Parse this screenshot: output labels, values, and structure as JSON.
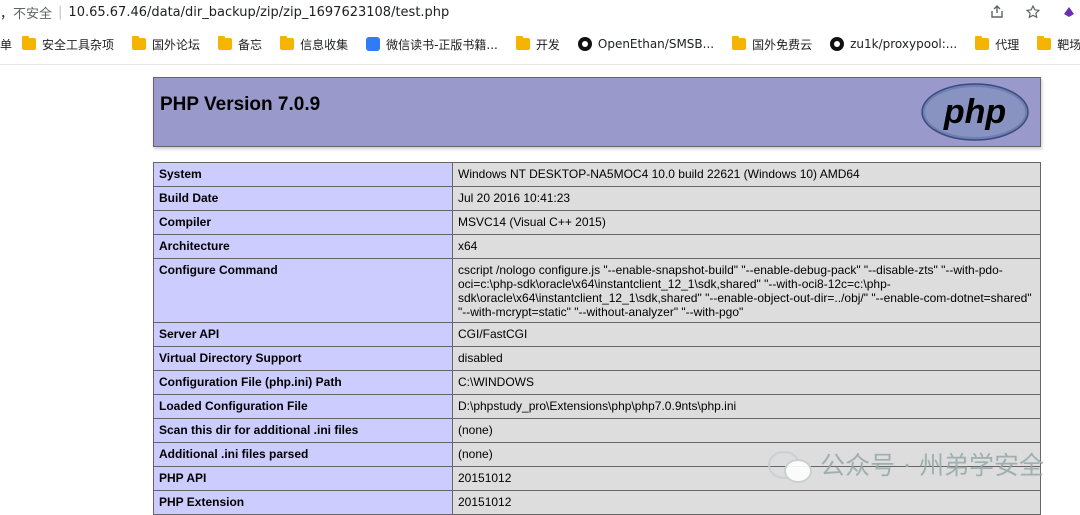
{
  "browser": {
    "insecure_label": "不安全",
    "separator": "|",
    "url": "10.65.67.46/data/dir_backup/zip/zip_1697623108/test.php",
    "leading_fragment": "，",
    "bookmarks": [
      {
        "icon": "folder-icon",
        "label": "安全工具杂项"
      },
      {
        "icon": "folder-icon",
        "label": "国外论坛"
      },
      {
        "icon": "folder-icon",
        "label": "备忘"
      },
      {
        "icon": "folder-icon",
        "label": "信息收集"
      },
      {
        "icon": "weread-icon",
        "label": "微信读书-正版书籍..."
      },
      {
        "icon": "folder-icon",
        "label": "开发"
      },
      {
        "icon": "github-icon",
        "label": "OpenEthan/SMSB..."
      },
      {
        "icon": "folder-icon",
        "label": "国外免费云"
      },
      {
        "icon": "github-icon",
        "label": "zu1k/proxypool:..."
      },
      {
        "icon": "folder-icon",
        "label": "代理"
      },
      {
        "icon": "folder-icon",
        "label": "靶场"
      }
    ],
    "bookmarks_leading": "单"
  },
  "phpinfo": {
    "title": "PHP Version 7.0.9",
    "logo_text": "php",
    "rows": [
      {
        "key": "System",
        "value": "Windows NT DESKTOP-NA5MOC4 10.0 build 22621 (Windows 10) AMD64"
      },
      {
        "key": "Build Date",
        "value": "Jul 20 2016 10:41:23"
      },
      {
        "key": "Compiler",
        "value": "MSVC14 (Visual C++ 2015)"
      },
      {
        "key": "Architecture",
        "value": "x64"
      },
      {
        "key": "Configure Command",
        "value": "cscript /nologo configure.js \"--enable-snapshot-build\" \"--enable-debug-pack\" \"--disable-zts\" \"--with-pdo-oci=c:\\php-sdk\\oracle\\x64\\instantclient_12_1\\sdk,shared\" \"--with-oci8-12c=c:\\php-sdk\\oracle\\x64\\instantclient_12_1\\sdk,shared\" \"--enable-object-out-dir=../obj/\" \"--enable-com-dotnet=shared\" \"--with-mcrypt=static\" \"--without-analyzer\" \"--with-pgo\""
      },
      {
        "key": "Server API",
        "value": "CGI/FastCGI"
      },
      {
        "key": "Virtual Directory Support",
        "value": "disabled"
      },
      {
        "key": "Configuration File (php.ini) Path",
        "value": "C:\\WINDOWS"
      },
      {
        "key": "Loaded Configuration File",
        "value": "D:\\phpstudy_pro\\Extensions\\php\\php7.0.9nts\\php.ini"
      },
      {
        "key": "Scan this dir for additional .ini files",
        "value": "(none)"
      },
      {
        "key": "Additional .ini files parsed",
        "value": "(none)"
      },
      {
        "key": "PHP API",
        "value": "20151012"
      },
      {
        "key": "PHP Extension",
        "value": "20151012"
      }
    ]
  },
  "watermark": "公众号 · 州弟学安全"
}
